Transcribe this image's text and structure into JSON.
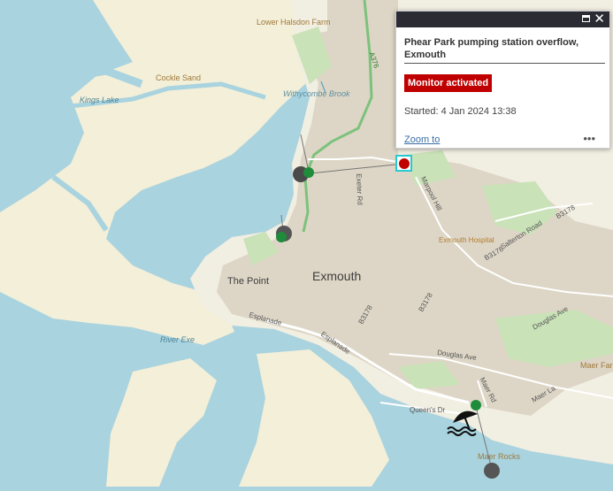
{
  "map": {
    "labels": {
      "lower_halsdon_farm": "Lower Halsdon Farm",
      "cockle_sand": "Cockle Sand",
      "kings_lake": "Kings Lake",
      "withycombe_brook": "Withycombe Brook",
      "a376": "A376",
      "exeter_rd": "Exeter Rd",
      "marpool_hill": "Marpool Hill",
      "b3178_a": "B3178",
      "b3178_b": "B3178",
      "b3178_c": "B3178",
      "b3178_d": "B3178",
      "salterton_road": "Salterton Road",
      "exmouth_hospital": "Exmouth Hospital",
      "the_point": "The Point",
      "exmouth": "Exmouth",
      "esplanade_a": "Esplanade",
      "esplanade_b": "Esplanade",
      "river_exe": "River Exe",
      "douglas_ave_a": "Douglas Ave",
      "douglas_ave_b": "Douglas Ave",
      "maer_rd": "Maer Rd",
      "maer_la": "Maer La",
      "maer_farm": "Maer Farm",
      "queens_dr": "Queen's Dr",
      "maer_rocks": "Maer Rocks"
    },
    "colors": {
      "water": "#a9d3df",
      "land": "#f1eee2",
      "sand": "#f3efd8",
      "urban": "#ddd6c6",
      "green": "#c9e2b7",
      "monitor_active": "#c00000",
      "outfall_ok": "#1e8c3a",
      "outfall_offline": "#555555"
    }
  },
  "popup": {
    "title": "Phear Park pumping station overflow, Exmouth",
    "badge": "Monitor activated",
    "started": "Started: 4 Jan 2024 13:38",
    "zoom_link": "Zoom to",
    "more": "•••",
    "maximize_icon": "maximize-icon",
    "close_icon": "close-icon",
    "close": "✕"
  }
}
